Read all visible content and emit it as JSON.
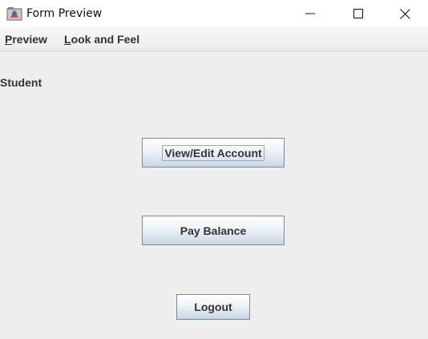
{
  "window": {
    "title": "Form Preview",
    "minimize_glyph": "—",
    "maximize_glyph": "☐",
    "close_glyph": "✕"
  },
  "menubar": {
    "items": [
      {
        "mnemonic": "P",
        "rest": "review"
      },
      {
        "mnemonic": "L",
        "rest": "ook and Feel"
      }
    ]
  },
  "content": {
    "heading": "Student",
    "buttons": {
      "view_edit": "View/Edit Account",
      "pay_balance": "Pay Balance",
      "logout": "Logout"
    }
  },
  "icons": [
    "java-app-icon",
    "minimize-icon",
    "maximize-icon",
    "close-icon"
  ],
  "colors": {
    "background": "#eeeeee",
    "button_border": "#7a8a99",
    "text": "#333333"
  }
}
